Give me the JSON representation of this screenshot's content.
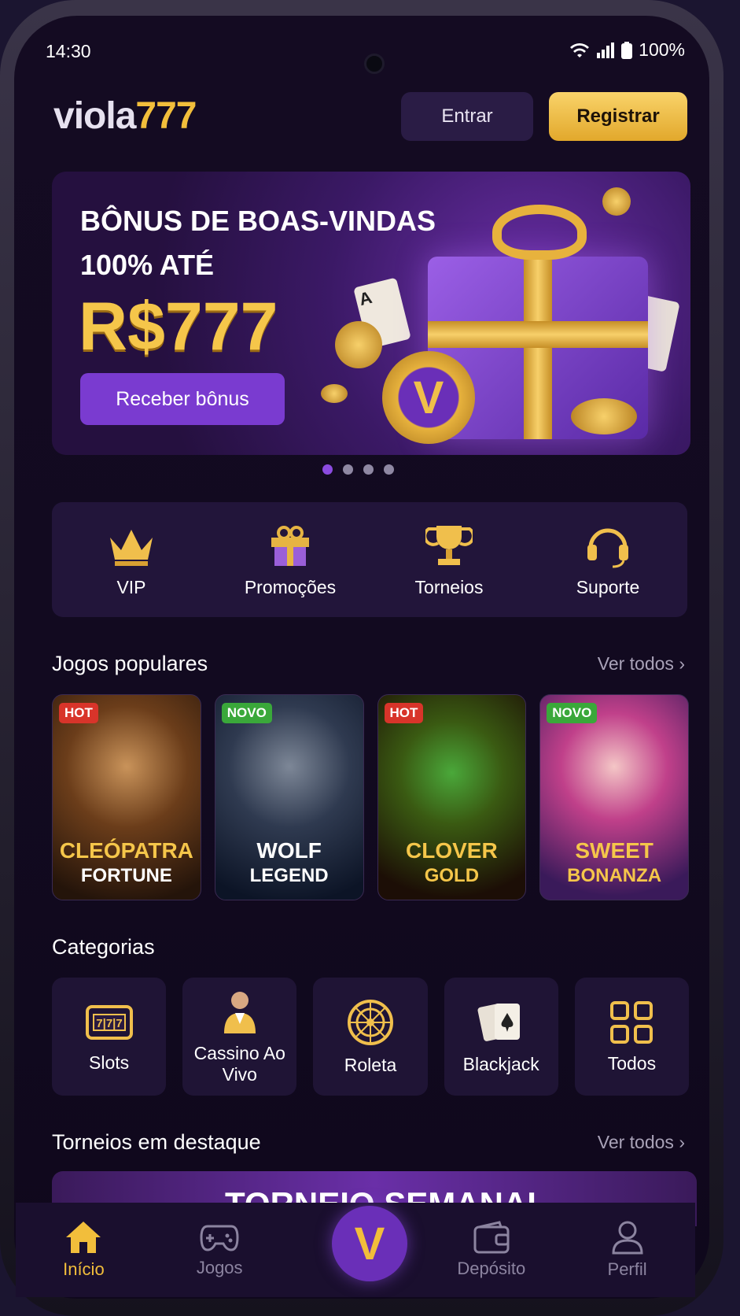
{
  "status": {
    "time": "14:30",
    "battery": "100%"
  },
  "header": {
    "logo_a": "viola",
    "logo_b": "777",
    "login": "Entrar",
    "register": "Registrar"
  },
  "banner": {
    "line1": "BÔNUS DE BOAS-VINDAS",
    "line2": "100% ATÉ",
    "amount": "R$777",
    "cta": "Receber bônus",
    "card_text": "A",
    "coin_letter": "V"
  },
  "quick": [
    "VIP",
    "Promoções",
    "Torneios",
    "Suporte"
  ],
  "popular": {
    "title": "Jogos populares",
    "see_all": "Ver todos",
    "games": [
      {
        "tag": "HOT",
        "t1": "CLEÓPATRA",
        "t2": "FORTUNE"
      },
      {
        "tag": "NOVO",
        "t1": "WOLF",
        "t2": "LEGEND"
      },
      {
        "tag": "HOT",
        "t1": "CLOVER",
        "t2": "GOLD"
      },
      {
        "tag": "NOVO",
        "t1": "SWEET",
        "t2": "BONANZA"
      }
    ]
  },
  "categories": {
    "title": "Categorias",
    "items": [
      "Slots",
      "Cassino Ao Vivo",
      "Roleta",
      "Blackjack",
      "Todos"
    ],
    "slot_reels": "7|7|7"
  },
  "tournaments": {
    "title": "Torneios em destaque",
    "see_all": "Ver todos",
    "banner": "TORNEIO SEMANAL"
  },
  "nav": {
    "home": "Início",
    "games": "Jogos",
    "deposit": "Depósito",
    "profile": "Perfil",
    "center": "V"
  }
}
